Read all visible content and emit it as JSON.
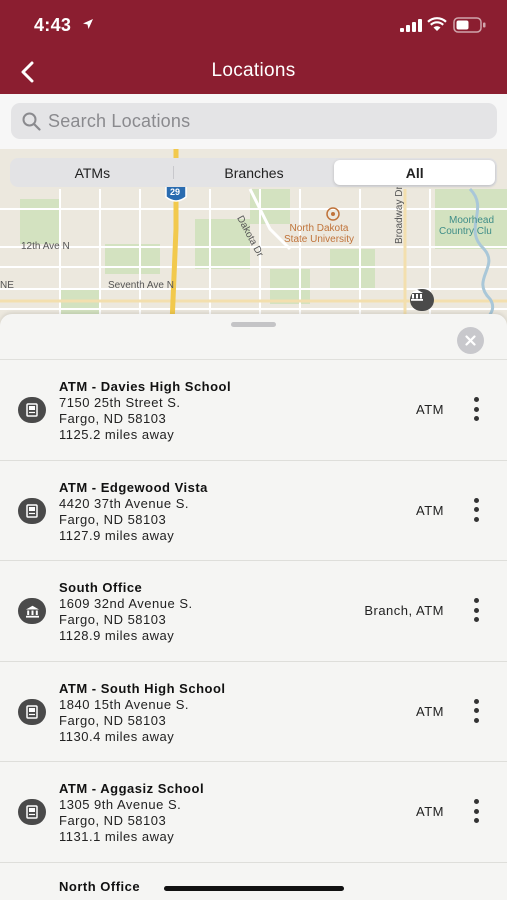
{
  "colors": {
    "brand": "#8b1e30",
    "icon_bg": "#4a4a4a"
  },
  "status": {
    "time": "4:43",
    "icons": [
      "location-arrow-icon",
      "signal-icon",
      "wifi-icon",
      "battery-icon"
    ]
  },
  "nav": {
    "title": "Locations",
    "back_icon": "chevron-left-icon"
  },
  "search": {
    "placeholder": "Search Locations",
    "value": ""
  },
  "filter": {
    "segments": [
      "ATMs",
      "Branches",
      "All"
    ],
    "selected": "All"
  },
  "map": {
    "labels": {
      "street_12th": "12th Ave N",
      "street_seventh": "Seventh Ave N",
      "dakota_dr": "Dakota Dr",
      "broadway": "Broadway Dr",
      "ndsu_1": "North Dakota",
      "ndsu_2": "State University",
      "moorhead_1": "Moorhead",
      "moorhead_2": "Country Clu",
      "interstate": "29",
      "ne_edge": "NE"
    }
  },
  "locations": [
    {
      "name": "ATM - Davies High School",
      "street": "7150 25th Street S.",
      "city": "Fargo, ND 58103",
      "distance": "1125.2 miles away",
      "type": "ATM",
      "icon": "atm-icon"
    },
    {
      "name": "ATM - Edgewood Vista",
      "street": "4420 37th Avenue S.",
      "city": "Fargo, ND 58103",
      "distance": "1127.9 miles away",
      "type": "ATM",
      "icon": "atm-icon"
    },
    {
      "name": "South Office",
      "street": "1609 32nd Avenue S.",
      "city": "Fargo, ND 58103",
      "distance": "1128.9 miles away",
      "type": "Branch, ATM",
      "icon": "bank-icon"
    },
    {
      "name": "ATM - South High School",
      "street": "1840 15th Avenue S.",
      "city": "Fargo, ND 58103",
      "distance": "1130.4 miles away",
      "type": "ATM",
      "icon": "atm-icon"
    },
    {
      "name": "ATM - Aggasiz School",
      "street": "1305 9th Avenue S.",
      "city": "Fargo, ND 58103",
      "distance": "1131.1 miles away",
      "type": "ATM",
      "icon": "atm-icon"
    }
  ],
  "partial_location": {
    "name": "North Office"
  }
}
